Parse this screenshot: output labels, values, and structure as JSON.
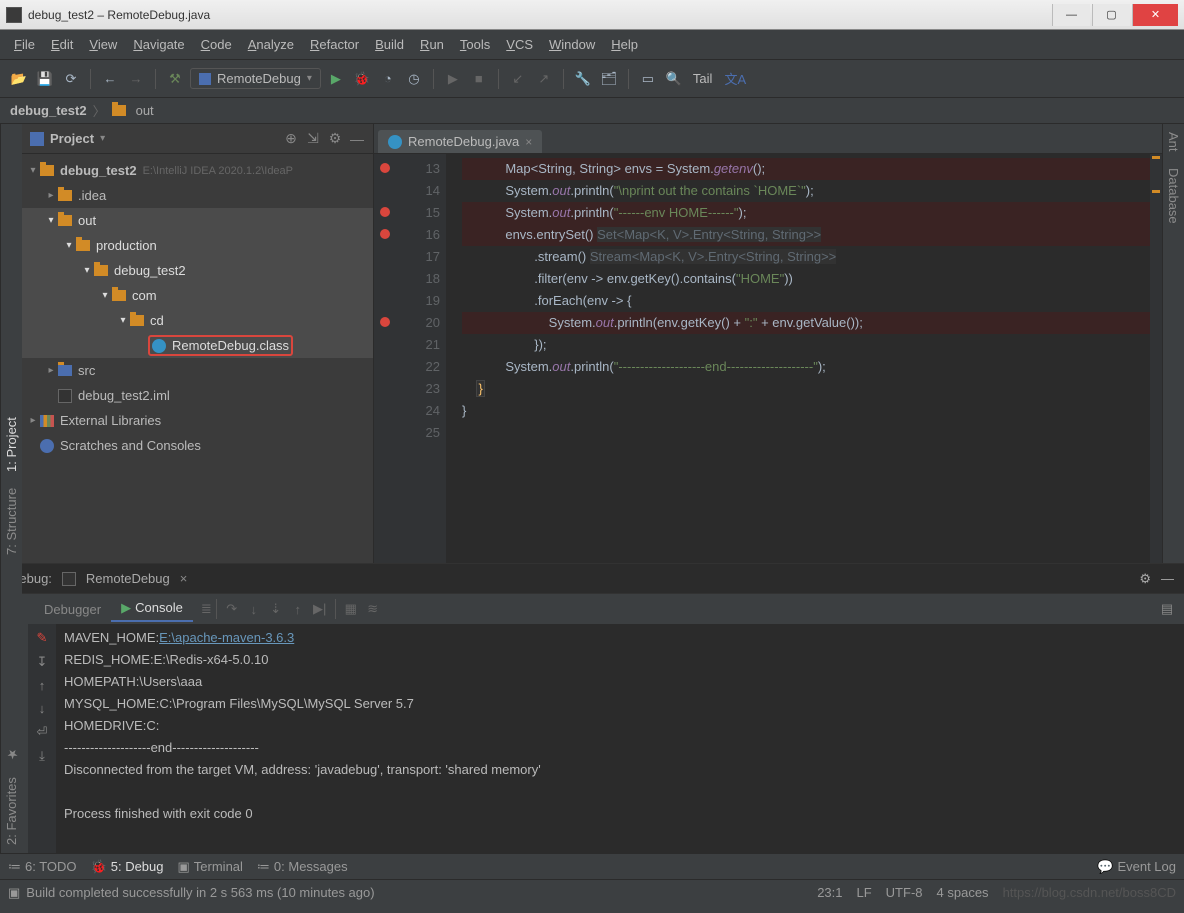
{
  "window": {
    "title": "debug_test2 – RemoteDebug.java"
  },
  "menu": [
    "File",
    "Edit",
    "View",
    "Navigate",
    "Code",
    "Analyze",
    "Refactor",
    "Build",
    "Run",
    "Tools",
    "VCS",
    "Window",
    "Help"
  ],
  "toolbar": {
    "run_config": "RemoteDebug",
    "tail": "Tail"
  },
  "breadcrumb": {
    "root": "debug_test2",
    "sep": "〉",
    "item": "out"
  },
  "project": {
    "title": "Project",
    "tree": {
      "root": {
        "name": "debug_test2",
        "path": "E:\\IntelliJ IDEA 2020.1.2\\IdeaP"
      },
      "idea": ".idea",
      "out": "out",
      "production": "production",
      "dbg2": "debug_test2",
      "com": "com",
      "cd": "cd",
      "class": "RemoteDebug.class",
      "src": "src",
      "iml": "debug_test2.iml",
      "ext": "External Libraries",
      "scratch": "Scratches and Consoles"
    }
  },
  "editor": {
    "tab": "RemoteDebug.java",
    "first_line": 13,
    "lines": [
      {
        "n": 13,
        "bp": true,
        "bpline": true,
        "html": "Map&lt;String, String&gt; envs = System.<span class='k-field'>getenv</span>();"
      },
      {
        "n": 14,
        "bp": false,
        "html": "System.<span class='k-field'>out</span>.println(<span class='k-str'>\"\\nprint out the contains `HOME`\"</span>);"
      },
      {
        "n": 15,
        "bp": true,
        "bpline": true,
        "html": "System.<span class='k-field'>out</span>.println(<span class='k-str'>\"------env HOME------\"</span>);"
      },
      {
        "n": 16,
        "bp": true,
        "bpline": true,
        "html": "envs.entrySet() <span class='k-hint'>Set&lt;Map&lt;K, V&gt;.Entry&lt;String, String&gt;&gt;</span>"
      },
      {
        "n": 17,
        "html": "        .stream() <span class='k-hint'>Stream&lt;Map&lt;K, V&gt;.Entry&lt;String, String&gt;&gt;</span>"
      },
      {
        "n": 18,
        "html": "        .filter(env -&gt; env.getKey().contains(<span class='k-str'>\"HOME\"</span>))"
      },
      {
        "n": 19,
        "html": "        .forEach(env -&gt; {"
      },
      {
        "n": 20,
        "bp": true,
        "bpline": true,
        "html": "            System.<span class='k-field'>out</span>.println(env.getKey() + <span class='k-str'>\":\"</span> + env.getValue());"
      },
      {
        "n": 21,
        "html": "        });"
      },
      {
        "n": 22,
        "html": "System.<span class='k-field'>out</span>.println(<span class='k-str'>\"--------------------end--------------------\"</span>);"
      },
      {
        "n": 23,
        "html": "<span class='yel'>}</span>",
        "brace": true,
        "indent": 2
      },
      {
        "n": 24,
        "html": "}",
        "indent": 1
      },
      {
        "n": 25,
        "html": ""
      }
    ]
  },
  "debug": {
    "label": "Debug:",
    "config": "RemoteDebug",
    "tabs": {
      "debugger": "Debugger",
      "console": "Console"
    },
    "console_lines": [
      {
        "t": "MAVEN_HOME:",
        "a": "E:\\apache-maven-3.6.3"
      },
      {
        "t": "REDIS_HOME:E:\\Redis-x64-5.0.10"
      },
      {
        "t": "HOMEPATH:\\Users\\aaa"
      },
      {
        "t": "MYSQL_HOME:C:\\Program Files\\MySQL\\MySQL Server 5.7"
      },
      {
        "t": "HOMEDRIVE:C:"
      },
      {
        "t": "--------------------end--------------------"
      },
      {
        "t": "Disconnected from the target VM, address: 'javadebug', transport: 'shared memory'"
      },
      {
        "t": ""
      },
      {
        "t": "Process finished with exit code 0"
      }
    ]
  },
  "bottom": {
    "todo": "6: TODO",
    "debug": "5: Debug",
    "terminal": "Terminal",
    "messages": "0: Messages",
    "eventlog": "Event Log"
  },
  "status": {
    "msg": "Build completed successfully in 2 s 563 ms (10 minutes ago)",
    "pos": "23:1",
    "lf": "LF",
    "enc": "UTF-8",
    "spaces": "4 spaces"
  },
  "sidetools": {
    "project": "1: Project",
    "structure": "7: Structure",
    "favorites": "2: Favorites",
    "ant": "Ant",
    "database": "Database"
  },
  "watermark": "https://blog.csdn.net/boss8CD"
}
